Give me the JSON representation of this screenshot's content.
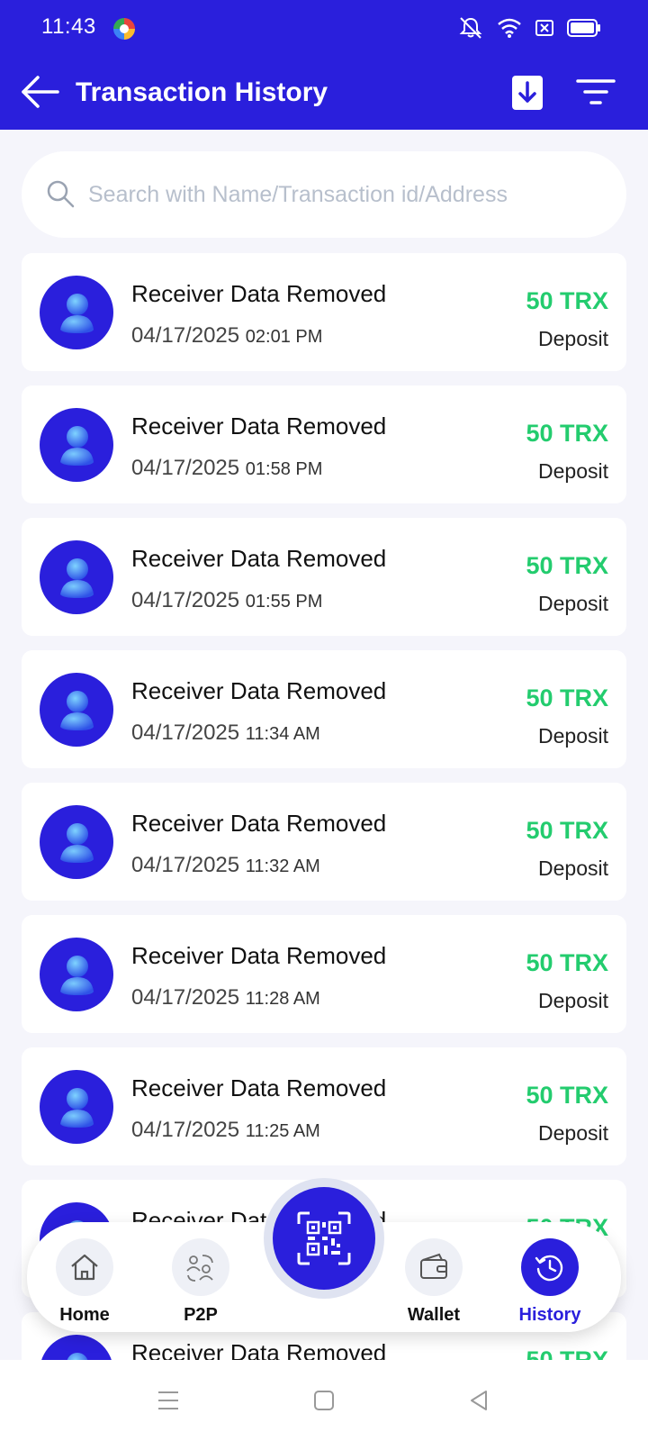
{
  "status_bar": {
    "time": "11:43"
  },
  "header": {
    "title": "Transaction History"
  },
  "search": {
    "placeholder": "Search with Name/Transaction id/Address",
    "value": ""
  },
  "transactions": [
    {
      "name": "Receiver Data Removed",
      "date": "04/17/2025",
      "time": "02:01 PM",
      "amount": "50 TRX",
      "type": "Deposit"
    },
    {
      "name": "Receiver Data Removed",
      "date": "04/17/2025",
      "time": "01:58 PM",
      "amount": "50 TRX",
      "type": "Deposit"
    },
    {
      "name": "Receiver Data Removed",
      "date": "04/17/2025",
      "time": "01:55 PM",
      "amount": "50 TRX",
      "type": "Deposit"
    },
    {
      "name": "Receiver Data Removed",
      "date": "04/17/2025",
      "time": "11:34 AM",
      "amount": "50 TRX",
      "type": "Deposit"
    },
    {
      "name": "Receiver Data Removed",
      "date": "04/17/2025",
      "time": "11:32 AM",
      "amount": "50 TRX",
      "type": "Deposit"
    },
    {
      "name": "Receiver Data Removed",
      "date": "04/17/2025",
      "time": "11:28 AM",
      "amount": "50 TRX",
      "type": "Deposit"
    },
    {
      "name": "Receiver Data Removed",
      "date": "04/17/2025",
      "time": "11:25 AM",
      "amount": "50 TRX",
      "type": "Deposit"
    },
    {
      "name": "Receiver Data Removed",
      "date": "",
      "time": "",
      "amount": "50 TRX",
      "type": ""
    },
    {
      "name": "Receiver Data Removed",
      "date": "",
      "time": "",
      "amount": "50 TRX",
      "type": ""
    }
  ],
  "bottom_nav": {
    "items": [
      {
        "label": "Home",
        "icon": "home-icon"
      },
      {
        "label": "P2P",
        "icon": "p2p-icon"
      },
      {
        "label": "Wallet",
        "icon": "wallet-icon"
      },
      {
        "label": "History",
        "icon": "history-icon",
        "active": true
      }
    ],
    "center_action": {
      "icon": "qr-scan-icon"
    }
  },
  "colors": {
    "primary": "#2a1fdc",
    "amount_green": "#23cc6e",
    "background": "#f5f5fb"
  }
}
